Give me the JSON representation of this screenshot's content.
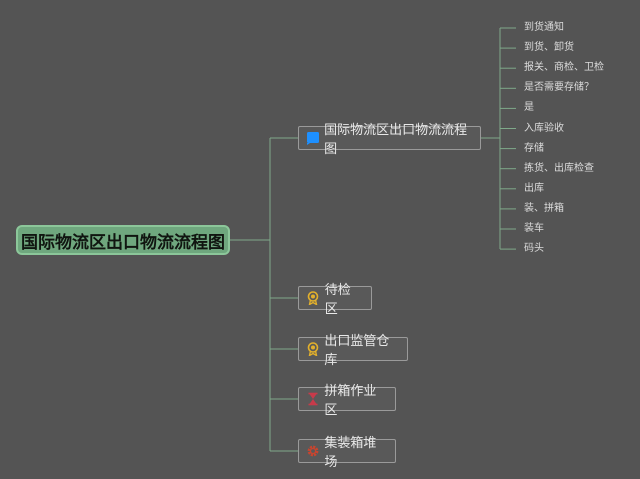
{
  "root": {
    "label": "国际物流区出口物流流程图"
  },
  "branches": [
    {
      "label": "国际物流区出口物流流程图",
      "icon": "flag-icon"
    },
    {
      "label": "待检区",
      "icon": "award-icon"
    },
    {
      "label": "出口监管仓库",
      "icon": "award-icon"
    },
    {
      "label": "拼箱作业区",
      "icon": "hourglass-icon"
    },
    {
      "label": "集装箱堆场",
      "icon": "gear-icon"
    }
  ],
  "leaves": [
    "到货通知",
    "到货、卸货",
    "报关、商检、卫检",
    "是否需要存储？",
    "是",
    "入库验收",
    "存储",
    "拣货、出库检查",
    "出库",
    "装、拼箱",
    "装车",
    "码头"
  ],
  "colors": {
    "background": "#545454",
    "root_fill": "#6fa77e",
    "connector": "#7fa98a",
    "flag_icon": "#1e90ff",
    "award_icon": "#e2b02c",
    "hourglass_icon": "#c83a4a",
    "gear_icon": "#c8452f"
  }
}
